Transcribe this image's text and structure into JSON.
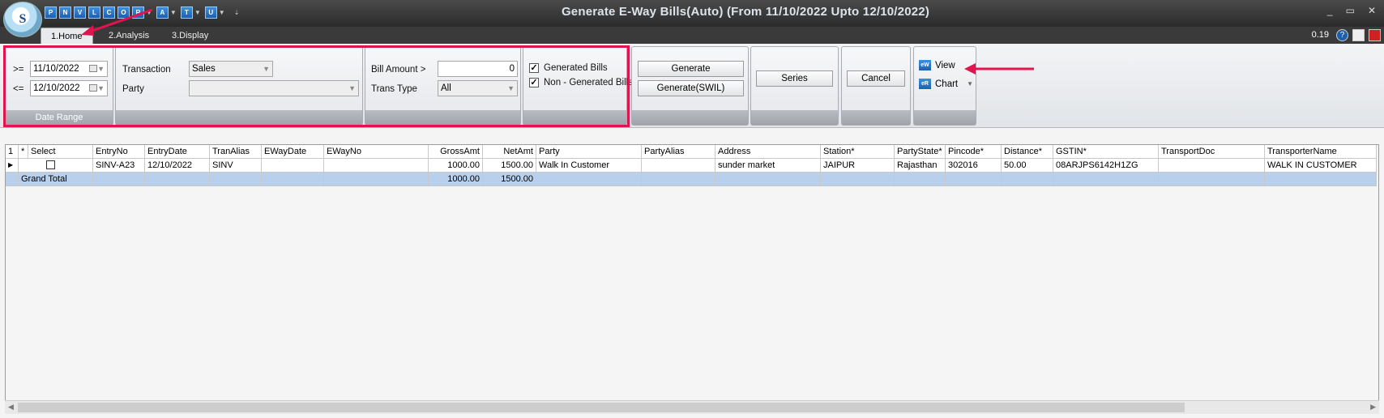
{
  "window": {
    "title": "Generate E-Way Bills(Auto) (From 11/10/2022 Upto 12/10/2022)",
    "logo_text": "S",
    "controls": [
      "_",
      "▭",
      "✕"
    ]
  },
  "quick_access": [
    {
      "label": "P"
    },
    {
      "label": "N"
    },
    {
      "label": "V"
    },
    {
      "label": "L"
    },
    {
      "label": "C"
    },
    {
      "label": "O"
    },
    {
      "label": "R"
    },
    {
      "label": "A"
    },
    {
      "label": "T"
    },
    {
      "label": "U"
    }
  ],
  "tabs": {
    "home": "1.Home",
    "analysis": "2.Analysis",
    "display": "3.Display",
    "version": "0.19"
  },
  "date_range": {
    "from_op": ">=",
    "from_value": "11/10/2022",
    "to_op": "<=",
    "to_value": "12/10/2022",
    "caption": "Date Range"
  },
  "filters": {
    "transaction_label": "Transaction",
    "transaction_value": "Sales",
    "party_label": "Party",
    "party_value": "",
    "bill_amount_label": "Bill Amount >",
    "bill_amount_value": "0",
    "trans_type_label": "Trans Type",
    "trans_type_value": "All"
  },
  "checkboxes": {
    "generated_label": "Generated Bills",
    "generated_checked": "✓",
    "non_generated_label": "Non - Generated Bills",
    "non_generated_checked": "✓"
  },
  "buttons": {
    "generate": "Generate",
    "generate_swil": "Generate(SWIL)",
    "series": "Series",
    "cancel": "Cancel",
    "view": "View",
    "chart": "Chart"
  },
  "grid": {
    "columns": [
      "1",
      "*",
      "Select",
      "EntryNo",
      "EntryDate",
      "TranAlias",
      "EWayDate",
      "EWayNo",
      "GrossAmt",
      "NetAmt",
      "Party",
      "PartyAlias",
      "Address",
      "Station*",
      "PartyState*",
      "Pincode*",
      "Distance*",
      "GSTIN*",
      "TransportDoc",
      "TransporterName"
    ],
    "rows": [
      [
        "",
        "",
        "",
        "SINV-A23",
        "12/10/2022",
        "SINV",
        "",
        "",
        "1000.00",
        "1500.00",
        "Walk In Customer",
        "",
        "sunder market",
        "JAIPUR",
        "Rajasthan",
        "302016",
        "50.00",
        "08ARJPS6142H1ZG",
        "",
        "WALK IN CUSTOMER"
      ]
    ],
    "total": [
      "",
      "",
      "Grand Total",
      "",
      "",
      "",
      "",
      "",
      "1000.00",
      "1500.00",
      "",
      "",
      "",
      "",
      "",
      "",
      "",
      "",
      "",
      ""
    ]
  },
  "colors": {
    "highlight": "#e0144f",
    "total_row": "#b9d0ec",
    "titlebar": "#2b2b2b"
  }
}
